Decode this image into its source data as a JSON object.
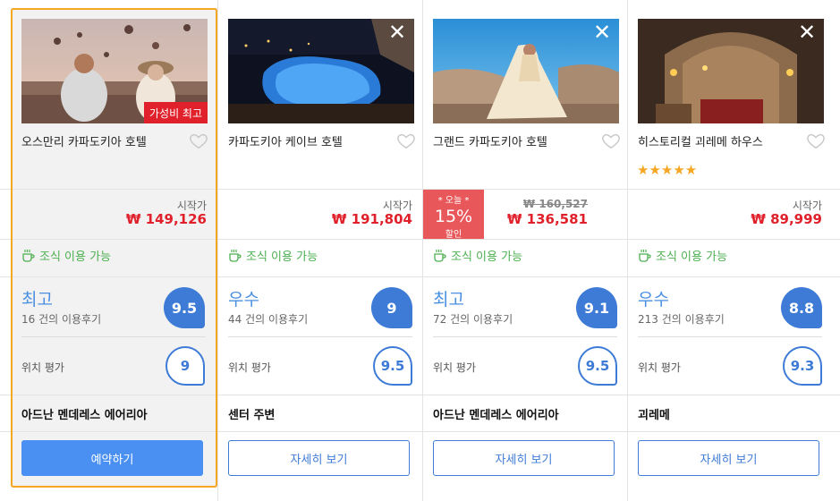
{
  "hotels": [
    {
      "name": "오스만리 카파도키아 호텔",
      "badge": "가성비 최고",
      "start_label": "시작가",
      "price": "₩ 149,126",
      "breakfast": "조식 이용 가능",
      "rating_word": "최고",
      "reviews": "16 건의 이용후기",
      "score": "9.5",
      "location_label": "위치 평가",
      "location_score": "9",
      "area": "아드난 멘데레스 에어리아",
      "button": "예약하기"
    },
    {
      "name": "카파도키아 케이브 호텔",
      "start_label": "시작가",
      "price": "₩ 191,804",
      "breakfast": "조식 이용 가능",
      "rating_word": "우수",
      "reviews": "44 건의 이용후기",
      "score": "9",
      "location_label": "위치 평가",
      "location_score": "9.5",
      "area": "센터 주변",
      "button": "자세히 보기"
    },
    {
      "name": "그랜드 카파도키아 호텔",
      "deal_top": "* 오늘 *",
      "deal_pct": "15%",
      "deal_bottom": "할인",
      "old_price": "₩ 160,527",
      "price": "₩ 136,581",
      "breakfast": "조식 이용 가능",
      "rating_word": "최고",
      "reviews": "72 건의 이용후기",
      "score": "9.1",
      "location_label": "위치 평가",
      "location_score": "9.5",
      "area": "아드난 멘데레스 에어리아",
      "button": "자세히 보기"
    },
    {
      "name": "히스토리컬 괴레메 하우스",
      "stars": "★★★★★",
      "star_count": 5,
      "start_label": "시작가",
      "price": "₩ 89,999",
      "breakfast": "조식 이용 가능",
      "rating_word": "우수",
      "reviews": "213 건의 이용후기",
      "score": "8.8",
      "location_label": "위치 평가",
      "location_score": "9.3",
      "area": "괴레메",
      "button": "자세히 보기"
    }
  ],
  "icons": {
    "close": "close-icon",
    "heart": "heart-icon",
    "coffee": "coffee-cup-icon",
    "star": "star-icon"
  },
  "colors": {
    "accent": "#3e7bd6",
    "price": "#e0202a",
    "breakfast": "#4caf50",
    "highlight_border": "#f5a623",
    "deal": "#e8575a"
  }
}
